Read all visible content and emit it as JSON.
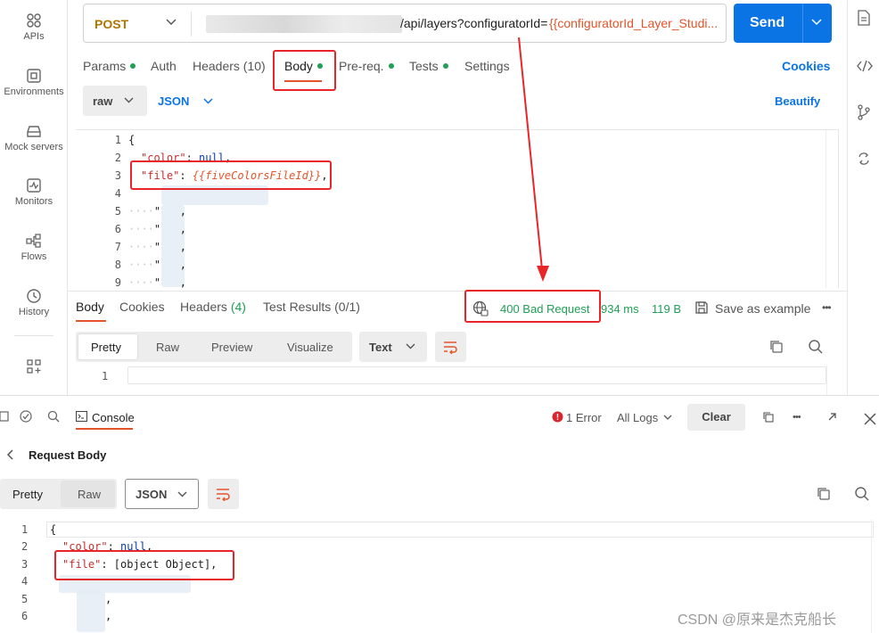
{
  "sidebar": {
    "items": [
      {
        "label": "APIs",
        "icon": "apis-icon"
      },
      {
        "label": "Environments",
        "icon": "environments-icon"
      },
      {
        "label": "Mock servers",
        "icon": "mock-servers-icon"
      },
      {
        "label": "Monitors",
        "icon": "monitors-icon"
      },
      {
        "label": "Flows",
        "icon": "flows-icon"
      },
      {
        "label": "History",
        "icon": "history-icon"
      }
    ]
  },
  "request": {
    "method": "POST",
    "url_path": "/api/layers?configuratorId=",
    "url_variable": "{{configuratorId_Layer_Studi...",
    "send_label": "Send"
  },
  "request_tabs": {
    "params": "Params",
    "auth": "Auth",
    "headers": "Headers (10)",
    "body": "Body",
    "prereq": "Pre-req.",
    "tests": "Tests",
    "settings": "Settings",
    "cookies": "Cookies"
  },
  "body_options": {
    "mode": "raw",
    "language": "JSON",
    "beautify": "Beautify"
  },
  "request_body": {
    "lines": [
      "1",
      "2",
      "3",
      "4",
      "5",
      "6",
      "7",
      "8",
      "9"
    ],
    "l1": "{",
    "l2_key": "\"color\"",
    "l2_sep": ": ",
    "l2_val": "null",
    "l2_end": ",",
    "l3_key": "\"file\"",
    "l3_sep": ": ",
    "l3_val": "{{fiveColorsFileId}}",
    "l3_end": ","
  },
  "response": {
    "tabs": {
      "body": "Body",
      "cookies": "Cookies",
      "headers_label": "Headers",
      "headers_count": "(4)",
      "tests_label": "Test Results",
      "tests_count": "(0/1)"
    },
    "status": "400 Bad Request",
    "time": "934 ms",
    "size": "119 B",
    "save": "Save as example",
    "more": "•••",
    "view_tabs": [
      "Pretty",
      "Raw",
      "Preview",
      "Visualize"
    ],
    "format": "Text",
    "line1": "1"
  },
  "console": {
    "tab": "Console",
    "error": "1 Error",
    "logs": "All Logs",
    "clear": "Clear",
    "more": "•••",
    "section": "Request Body",
    "view_pretty": "Pretty",
    "view_raw": "Raw",
    "format": "JSON",
    "lines": [
      "1",
      "2",
      "3",
      "4",
      "5",
      "6"
    ],
    "l1": "{",
    "l2_key": "\"color\"",
    "l2_sep": ": ",
    "l2_val": "null",
    "l2_end": ",",
    "l3_key": "\"file\"",
    "l3_rest": ": [object Object],"
  },
  "watermark": "CSDN @原来是杰克船长",
  "colors": {
    "accent": "#0b74e5",
    "error_red": "#e8262a",
    "success_green": "#1fa055",
    "method_orange": "#b07600"
  }
}
